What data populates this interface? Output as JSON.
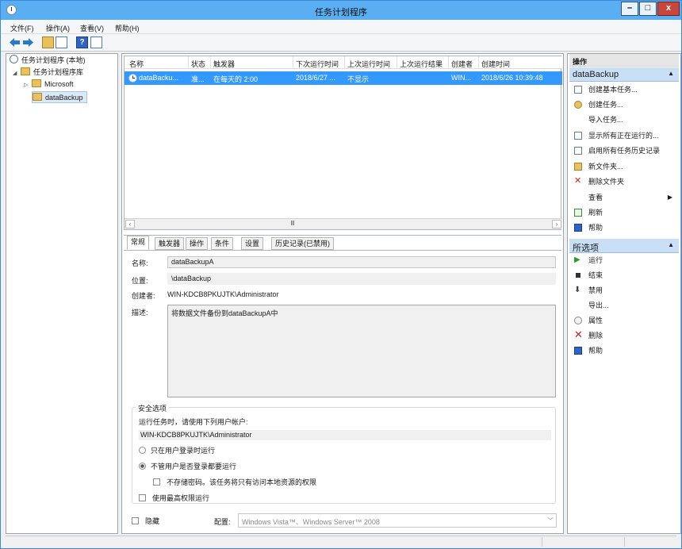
{
  "window": {
    "title": "任务计划程序"
  },
  "menu": [
    "文件(F)",
    "操作(A)",
    "查看(V)",
    "帮助(H)"
  ],
  "tree": {
    "root": "任务计划程序 (本地)",
    "library": "任务计划程序库",
    "children": [
      "Microsoft",
      "dataBackup"
    ]
  },
  "list": {
    "columns": [
      "名称",
      "状态",
      "触发器",
      "下次运行时间",
      "上次运行时间",
      "上次运行结果",
      "创建者",
      "创建时间"
    ],
    "rows": [
      {
        "name": "dataBacku...",
        "status": "准...",
        "trigger": "在每天的 2:00",
        "next_run": "2018/6/27 ...",
        "last_run": "不显示",
        "last_result": "",
        "author": "WIN...",
        "created": "2018/6/26 10:39:48"
      }
    ],
    "scroll_grip": "Ⅲ"
  },
  "tabs": [
    "常规",
    "触发器",
    "操作",
    "条件",
    "设置",
    "历史记录(已禁用)"
  ],
  "general": {
    "name_label": "名称:",
    "name_value": "dataBackupA",
    "location_label": "位置:",
    "location_value": "\\dataBackup",
    "author_label": "创建者:",
    "author_value": "WIN-KDCB8PKUJTK\\Administrator",
    "desc_label": "描述:",
    "desc_value": "将数据文件备份到dataBackupA中"
  },
  "security": {
    "title": "安全选项",
    "run_as_label": "运行任务时，请使用下列用户帐户:",
    "run_as_value": "WIN-KDCB8PKUJTK\\Administrator",
    "option_logged_on": "只在用户登录时运行",
    "option_whether": "不管用户是否登录都要运行",
    "no_store_password": "不存储密码。该任务将只有访问本地资源的权限",
    "highest_privileges": "使用最高权限运行"
  },
  "bottom": {
    "hidden_label": "隐藏",
    "configure_label": "配置:",
    "configure_value": "Windows Vista™、Windows Server™ 2008"
  },
  "actions": {
    "header": "操作",
    "section1": "dataBackup",
    "items1": [
      "创建基本任务...",
      "创建任务...",
      "导入任务...",
      "显示所有正在运行的...",
      "启用所有任务历史记录",
      "新文件夹...",
      "删除文件夹",
      "查看",
      "刷新",
      "帮助"
    ],
    "section2": "所选项",
    "items2": [
      "运行",
      "结束",
      "禁用",
      "导出...",
      "属性",
      "删除",
      "帮助"
    ]
  }
}
